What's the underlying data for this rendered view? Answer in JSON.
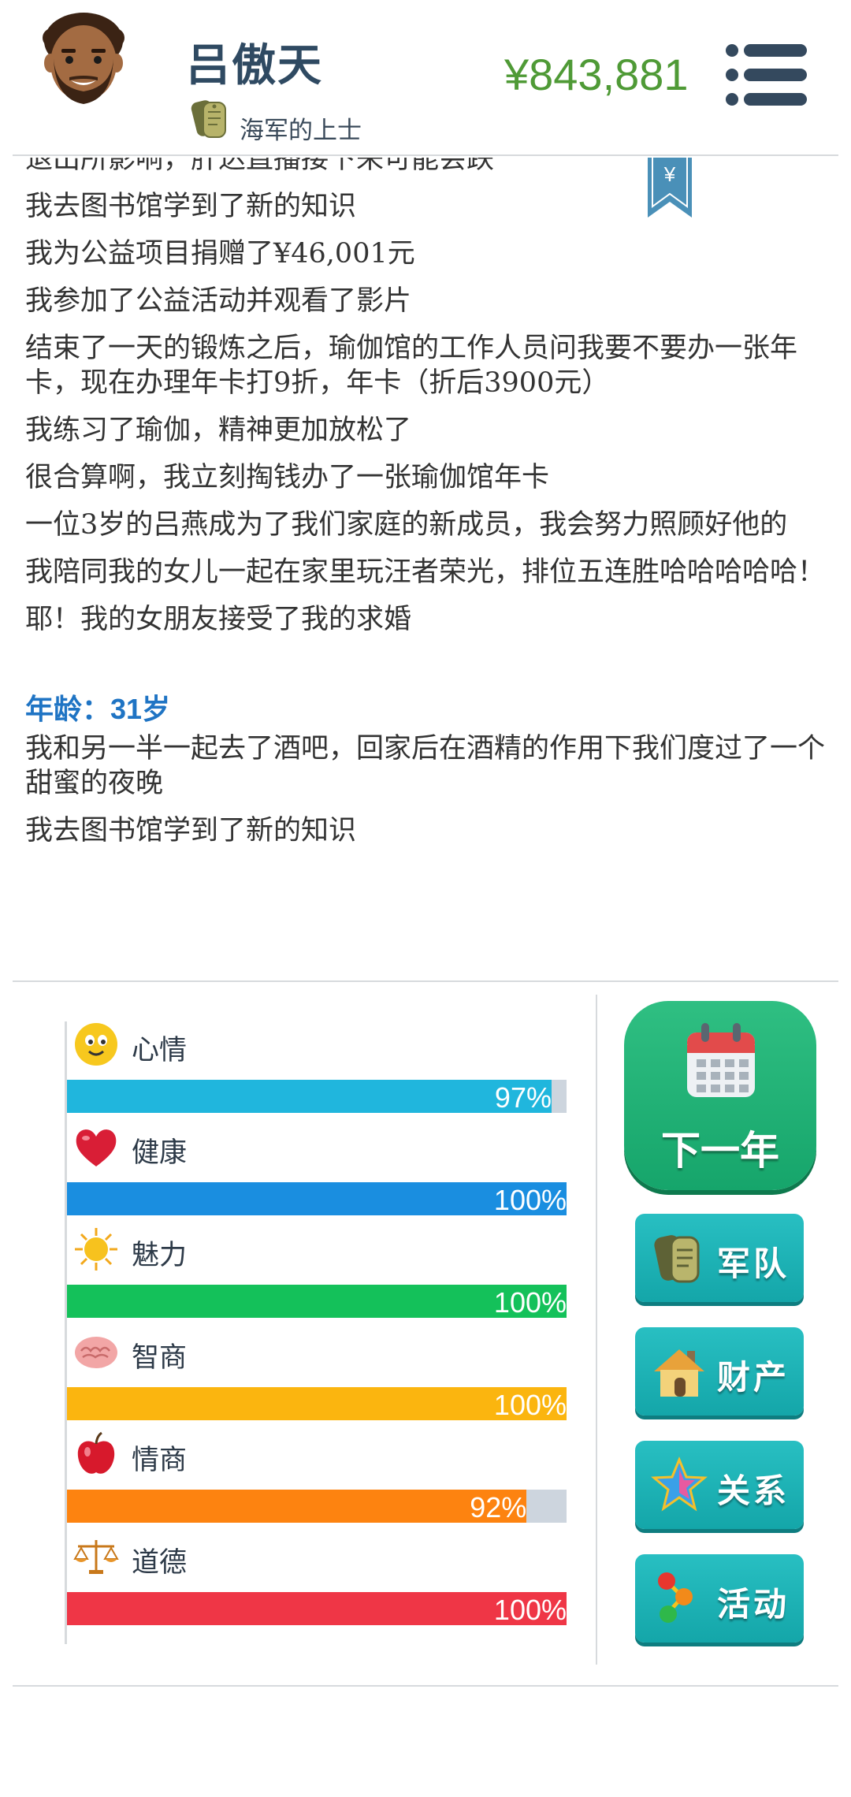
{
  "header": {
    "name": "吕傲天",
    "rank": "海军的上士",
    "money": "¥843,881"
  },
  "log": {
    "partial_line": "退出所影响，肝达直播接下来可能会跌",
    "bookmark_symbol": "¥",
    "entries_before": [
      "我去图书馆学到了新的知识",
      "我为公益项目捐赠了¥46,001元",
      "我参加了公益活动并观看了影片",
      "结束了一天的锻炼之后，瑜伽馆的工作人员问我要不要办一张年卡，现在办理年卡打9折，年卡（折后3900元）",
      "我练习了瑜伽，精神更加放松了",
      "很合算啊，我立刻掏钱办了一张瑜伽馆年卡",
      "一位3岁的吕燕成为了我们家庭的新成员，我会努力照顾好他的",
      "我陪同我的女儿一起在家里玩汪者荣光，排位五连胜哈哈哈哈哈！",
      "耶！我的女朋友接受了我的求婚"
    ],
    "age_heading": "年龄：31岁",
    "entries_after": [
      "我和另一半一起去了酒吧，回家后在酒精的作用下我们度过了一个甜蜜的夜晚",
      "我去图书馆学到了新的知识"
    ]
  },
  "stats": [
    {
      "label": "心情",
      "value": 97,
      "display": "97%",
      "color": "#20b6dd",
      "icon": "smiley-icon"
    },
    {
      "label": "健康",
      "value": 100,
      "display": "100%",
      "color": "#1a8ee0",
      "icon": "heart-icon"
    },
    {
      "label": "魅力",
      "value": 100,
      "display": "100%",
      "color": "#14c15a",
      "icon": "sun-icon"
    },
    {
      "label": "智商",
      "value": 100,
      "display": "100%",
      "color": "#fbb50f",
      "icon": "brain-icon"
    },
    {
      "label": "情商",
      "value": 92,
      "display": "92%",
      "color": "#fd8310",
      "icon": "apple-icon"
    },
    {
      "label": "道德",
      "value": 100,
      "display": "100%",
      "color": "#ef3646",
      "icon": "scales-icon"
    }
  ],
  "actions": {
    "next_year": "下一年",
    "military": "军队",
    "assets": "财产",
    "relations": "关系",
    "activities": "活动"
  },
  "colors": {
    "money": "#4f9a36",
    "age_heading": "#1f74c4",
    "next_button": "#1eae72",
    "side_button": "#1cb2b5",
    "bar_track": "#cdd5de"
  }
}
